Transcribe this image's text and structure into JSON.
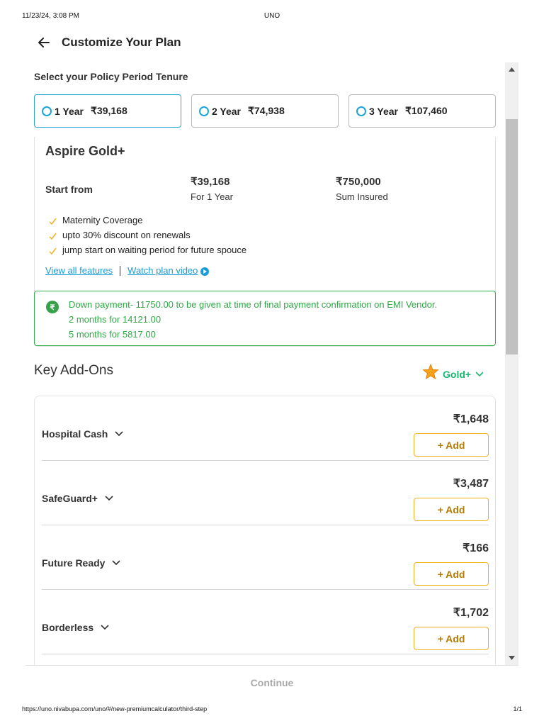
{
  "print_header": {
    "date": "11/23/24, 3:08 PM",
    "title": "UNO"
  },
  "print_footer": {
    "url": "https://uno.nivabupa.com/uno/#/new-premiumcalculator/third-step",
    "page": "1/1"
  },
  "header": {
    "title": "Customize Your Plan",
    "back_icon": "arrow-left-icon"
  },
  "tenure": {
    "label": "Select your Policy Period Tenure",
    "options": [
      {
        "years": "1 Year",
        "price": "₹39,168",
        "selected": true
      },
      {
        "years": "2 Year",
        "price": "₹74,938",
        "selected": false
      },
      {
        "years": "3 Year",
        "price": "₹107,460",
        "selected": false
      }
    ]
  },
  "plan": {
    "name": "Aspire Gold+",
    "start_label": "Start from",
    "premium": {
      "value": "₹39,168",
      "label": "For 1 Year"
    },
    "sum_insured": {
      "value": "₹750,000",
      "label": "Sum Insured"
    },
    "features": [
      "Maternity Coverage",
      "upto 30% discount on renewals",
      "jump start on waiting period for future spouce"
    ],
    "links": {
      "view_all": "View all features",
      "watch_video": "Watch plan video"
    }
  },
  "emi": {
    "lines": [
      "Down payment- 11750.00 to be given at time of final payment confirmation on EMI Vendor.",
      "2 months for 14121.00",
      "5 months for 5817.00"
    ]
  },
  "addons": {
    "title": "Key Add-Ons",
    "tier_label": "Gold+",
    "add_label": "+ Add",
    "items": [
      {
        "name": "Hospital Cash",
        "price": "₹1,648"
      },
      {
        "name": "SafeGuard+",
        "price": "₹3,487"
      },
      {
        "name": "Future Ready",
        "price": "₹166"
      },
      {
        "name": "Borderless",
        "price": "₹1,702"
      }
    ]
  },
  "footer": {
    "continue_label": "Continue"
  },
  "colors": {
    "accent_blue": "#1aa4dc",
    "success_green": "#2fa845",
    "addon_border": "#f0b020",
    "tier_green": "#19b96f"
  }
}
